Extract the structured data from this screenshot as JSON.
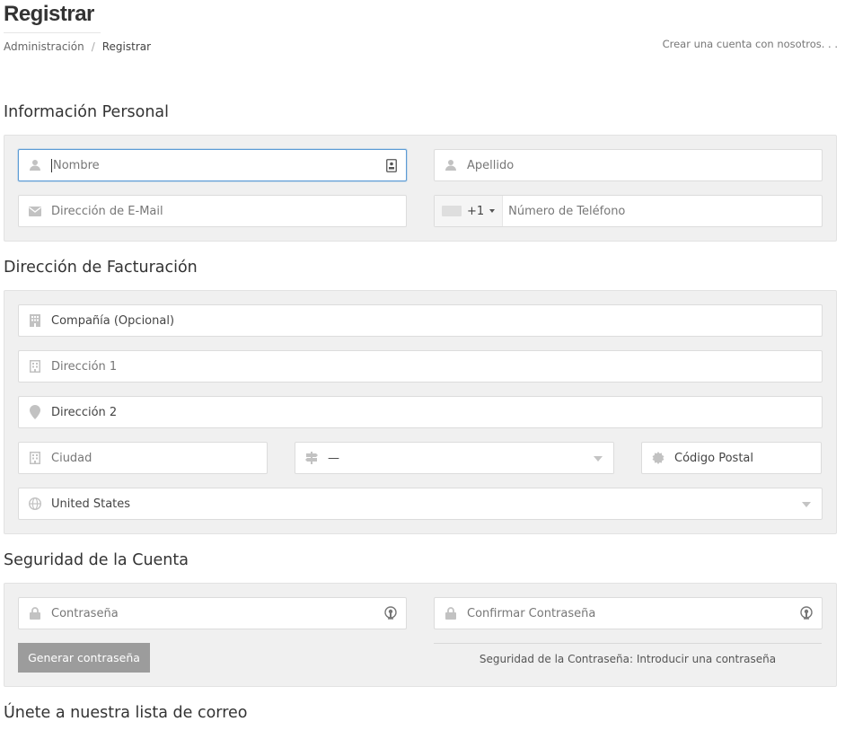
{
  "header": {
    "title": "Registrar",
    "breadcrumb": {
      "home": "Administración",
      "separator": "/",
      "current": "Registrar"
    },
    "tagline": "Crear una cuenta con nosotros. . ."
  },
  "sections": {
    "personal": "Información Personal",
    "billing": "Dirección de Facturación",
    "security": "Seguridad de la Cuenta",
    "mailing": "Únete a nuestra lista de correo"
  },
  "personal": {
    "first_name_placeholder": "Nombre",
    "last_name_placeholder": "Apellido",
    "email_placeholder": "Dirección de E-Mail",
    "phone_dial_code": "+1",
    "phone_placeholder": "Número de Teléfono"
  },
  "billing": {
    "company_placeholder": "Compañía (Opcional)",
    "address1_placeholder": "Dirección 1",
    "address2_placeholder": "Dirección 2",
    "city_placeholder": "Ciudad",
    "state_value": "—",
    "postcode_placeholder": "Código Postal",
    "country_value": "United States"
  },
  "security": {
    "password_placeholder": "Contraseña",
    "confirm_password_placeholder": "Confirmar Contraseña",
    "generate_button": "Generar contraseña",
    "strength_text": "Seguridad de la Contraseña: Introducir una contraseña"
  },
  "colors": {
    "panel_bg": "#f0f0f0",
    "focus_border": "#5b9bd5",
    "button_bg": "#9c9c9c",
    "icon_gray": "#c2c2c2"
  }
}
